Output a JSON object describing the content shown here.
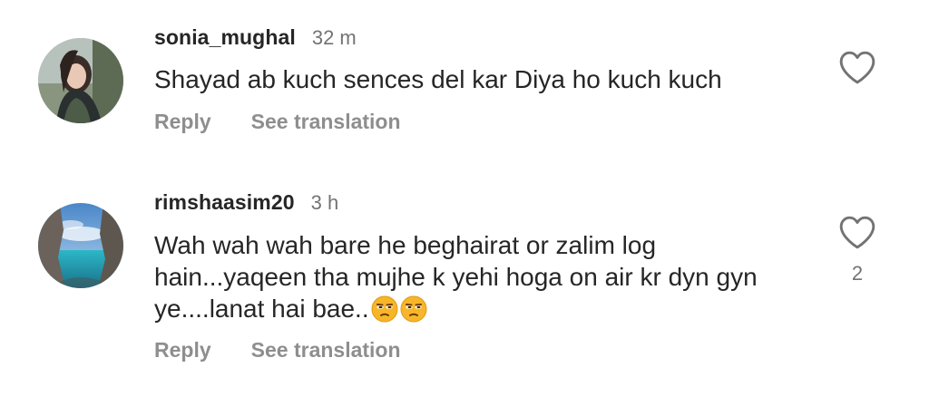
{
  "comments": [
    {
      "username": "sonia_mughal",
      "time": "32 m",
      "text": "Shayad ab kuch sences  del kar Diya ho kuch kuch",
      "reply_label": "Reply",
      "translate_label": "See translation",
      "like_count": ""
    },
    {
      "username": "rimshaasim20",
      "time": "3 h",
      "text": "Wah wah wah bare he beghairat or zalim log hain...yaqeen tha mujhe k yehi hoga on air kr dyn gyn ye....lanat hai bae..",
      "reply_label": "Reply",
      "translate_label": "See translation",
      "like_count": "2"
    }
  ],
  "icons": {
    "like": "heart-outline-icon",
    "emoji": "unamused-face-emoji"
  },
  "colors": {
    "text": "#262626",
    "secondary": "#737373",
    "emoji": "#f7b62a"
  }
}
